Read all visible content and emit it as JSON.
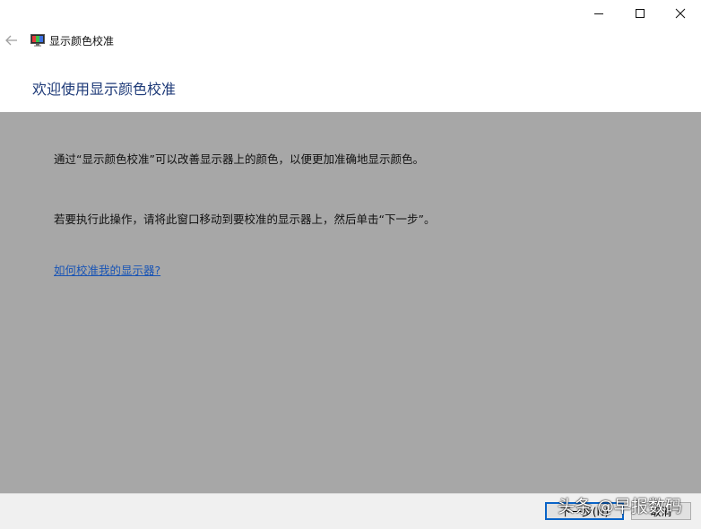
{
  "window": {
    "app_title": "显示颜色校准",
    "controls": [
      "minimize-icon",
      "maximize-icon",
      "close-icon"
    ]
  },
  "nav": {
    "back_icon": "back-arrow-icon",
    "app_icon": "display-color-calibration-icon"
  },
  "page": {
    "title": "欢迎使用显示颜色校准",
    "paragraph1": "通过“显示颜色校准”可以改善显示器上的颜色，以便更加准确地显示颜色。",
    "paragraph2": "若要执行此操作，请将此窗口移动到要校准的显示器上，然后单击“下一步”。",
    "help_link": "如何校准我的显示器?"
  },
  "footer": {
    "next_label": "下一步(N)",
    "cancel_label": "取消"
  },
  "watermark": "头条 @早报数码",
  "colors": {
    "content_bg": "#a7a7a7",
    "title_color": "#1e3a78",
    "link_color": "#1a55b5",
    "accent": "#0a64c8"
  }
}
